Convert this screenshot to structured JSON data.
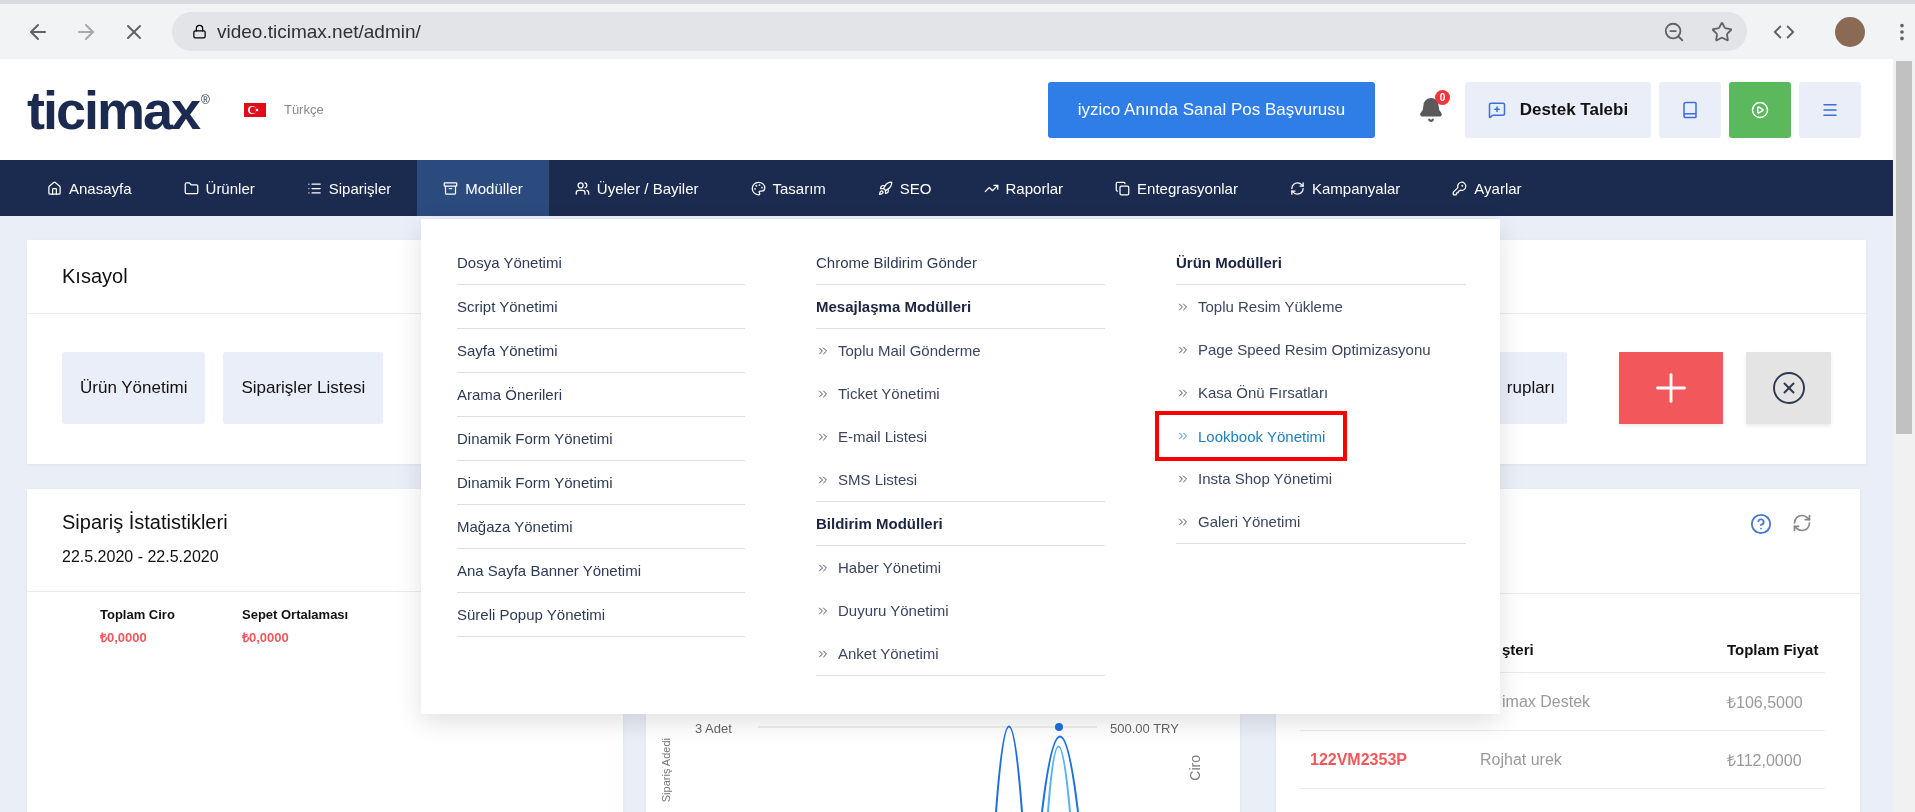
{
  "browser": {
    "url": "video.ticimax.net/admin/"
  },
  "header": {
    "logo": "ticimax",
    "logo_mark": "®",
    "language": "Türkçe",
    "promo_button": "iyzico Anında Sanal Pos Başvurusu",
    "notification_count": "0",
    "support_button": "Destek Talebi"
  },
  "nav": [
    {
      "label": "Anasayfa",
      "selected": false
    },
    {
      "label": "Ürünler",
      "selected": false
    },
    {
      "label": "Siparişler",
      "selected": false
    },
    {
      "label": "Modüller",
      "selected": true
    },
    {
      "label": "Üyeler / Bayiler",
      "selected": false
    },
    {
      "label": "Tasarım",
      "selected": false
    },
    {
      "label": "SEO",
      "selected": false
    },
    {
      "label": "Raporlar",
      "selected": false
    },
    {
      "label": "Entegrasyonlar",
      "selected": false
    },
    {
      "label": "Kampanyalar",
      "selected": false
    },
    {
      "label": "Ayarlar",
      "selected": false
    }
  ],
  "dropdown": {
    "columns": [
      {
        "entries": [
          {
            "kind": "link",
            "label": "Dosya Yönetimi"
          },
          {
            "kind": "link",
            "label": "Script Yönetimi"
          },
          {
            "kind": "link",
            "label": "Sayfa Yönetimi"
          },
          {
            "kind": "link",
            "label": "Arama Önerileri"
          },
          {
            "kind": "link",
            "label": "Dinamik Form Yönetimi"
          },
          {
            "kind": "link",
            "label": "Dinamik Form Yönetimi"
          },
          {
            "kind": "link",
            "label": "Mağaza Yönetimi"
          },
          {
            "kind": "link",
            "label": "Ana Sayfa Banner Yönetimi"
          },
          {
            "kind": "link",
            "label": "Süreli Popup Yönetimi"
          }
        ]
      },
      {
        "entries": [
          {
            "kind": "link",
            "label": "Chrome Bildirim Gönder"
          },
          {
            "kind": "heading",
            "label": "Mesajlaşma Modülleri"
          },
          {
            "kind": "group",
            "items": [
              {
                "label": "Toplu Mail Gönderme",
                "highlighted": false
              },
              {
                "label": "Ticket Yönetimi",
                "highlighted": false
              },
              {
                "label": "E-mail Listesi",
                "highlighted": false
              },
              {
                "label": "SMS Listesi",
                "highlighted": false
              }
            ]
          },
          {
            "kind": "heading",
            "label": "Bildirim Modülleri"
          },
          {
            "kind": "group",
            "items": [
              {
                "label": "Haber Yönetimi",
                "highlighted": false
              },
              {
                "label": "Duyuru Yönetimi",
                "highlighted": false
              },
              {
                "label": "Anket Yönetimi",
                "highlighted": false
              }
            ]
          }
        ]
      },
      {
        "entries": [
          {
            "kind": "heading",
            "label": "Ürün Modülleri"
          },
          {
            "kind": "group",
            "items": [
              {
                "label": "Toplu Resim Yükleme",
                "highlighted": false
              },
              {
                "label": "Page Speed Resim Optimizasyonu",
                "highlighted": false
              },
              {
                "label": "Kasa Önü Fırsatları",
                "highlighted": false
              },
              {
                "label": "Lookbook Yönetimi",
                "highlighted": true
              },
              {
                "label": "Insta Shop Yönetimi",
                "highlighted": false
              },
              {
                "label": "Galeri Yönetimi",
                "highlighted": false
              }
            ]
          }
        ]
      }
    ]
  },
  "shortcuts": {
    "title": "Kısayol",
    "tiles": [
      {
        "label": "Ürün Yönetimi"
      },
      {
        "label": "Siparişler Listesi"
      },
      {
        "label": "rupları"
      }
    ]
  },
  "order_stats": {
    "title": "Sipariş İstatistikleri",
    "date_range": "22.5.2020 - 22.5.2020",
    "stats": [
      {
        "label": "Toplam Ciro",
        "value": "₺0,0000"
      },
      {
        "label": "Sepet Ortalaması",
        "value": "₺0,0000"
      }
    ]
  },
  "chart": {
    "left_axis_label": "Sipariş Adedi",
    "right_axis_label": "Ciro",
    "left_tick": "3 Adet",
    "right_tick": "500.00 TRY"
  },
  "orders": {
    "columns": [
      "şteri",
      "Toplam Fiyat"
    ],
    "rows": [
      {
        "customer": "imax Destek",
        "total": "₺106,5000"
      },
      {
        "code": "122VM2353P",
        "customer": "Rojhat urek",
        "total": "₺112,0000"
      }
    ]
  }
}
